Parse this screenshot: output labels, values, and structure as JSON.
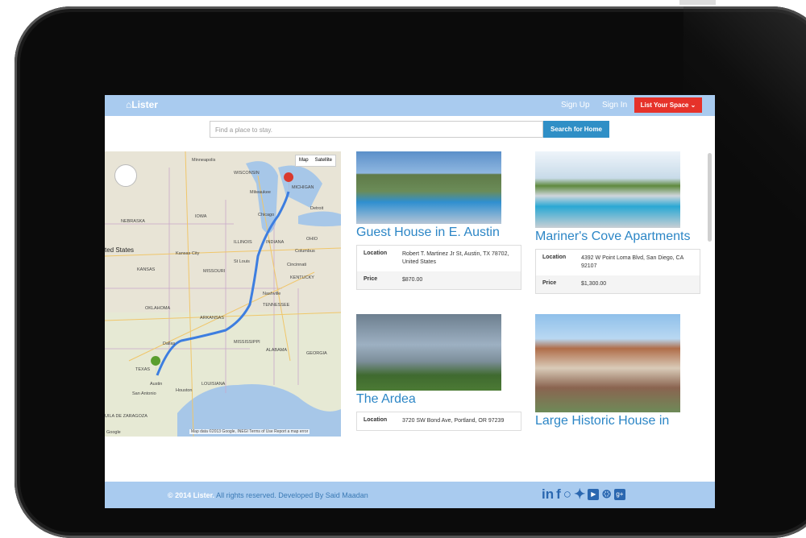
{
  "nav": {
    "brand": "Lister",
    "sign_up": "Sign Up",
    "sign_in": "Sign In",
    "list_space": "List Your Space"
  },
  "search": {
    "placeholder": "Find a place to stay.",
    "button": "Search for Home"
  },
  "map": {
    "map_label": "Map",
    "satellite_label": "Satellite",
    "footer": "Map data ©2013 Google, INEGI   Terms of Use   Report a map error",
    "place_labels": [
      "Minneapolis",
      "WISCONSIN",
      "MICHIGAN",
      "Milwaukee",
      "Detroit",
      "Chicago",
      "NEBRASKA",
      "IOWA",
      "ILLINOIS",
      "INDIANA",
      "OHIO",
      "ted States",
      "Kansas City",
      "Columbus",
      "KANSAS",
      "St Louis",
      "Cincinnati",
      "MISSOURI",
      "KENTUCKY",
      "Nashville",
      "OKLAHOMA",
      "TENNESSEE",
      "ARKANSAS",
      "Dallas",
      "MISSISSIPPI",
      "ALABAMA",
      "GEORGIA",
      "TEXAS",
      "LOUISIANA",
      "Houston",
      "San Antonio",
      "Austin",
      "UILA DE ZARAGOZA",
      "Google"
    ]
  },
  "listings": [
    {
      "title": "Guest House in E. Austin",
      "location_label": "Location",
      "location": "Robert T. Martinez Jr St, Austin, TX 78702, United States",
      "price_label": "Price",
      "price": "$870.00"
    },
    {
      "title": "Mariner's Cove Apartments",
      "location_label": "Location",
      "location": "4392 W Point Loma Blvd, San Diego, CA 92107",
      "price_label": "Price",
      "price": "$1,300.00"
    },
    {
      "title": "The Ardea",
      "location_label": "Location",
      "location": "3720 SW Bond Ave, Portland, OR 97239"
    },
    {
      "title": "Large Historic House in"
    }
  ],
  "footer": {
    "brand": "© 2014 Lister.",
    "text": " All rights reserved. Developed By Said Maadan"
  },
  "social_icons": [
    "linkedin-icon",
    "facebook-icon",
    "github-icon",
    "twitter-icon",
    "youtube-icon",
    "dribbble-icon",
    "google-plus-icon"
  ]
}
